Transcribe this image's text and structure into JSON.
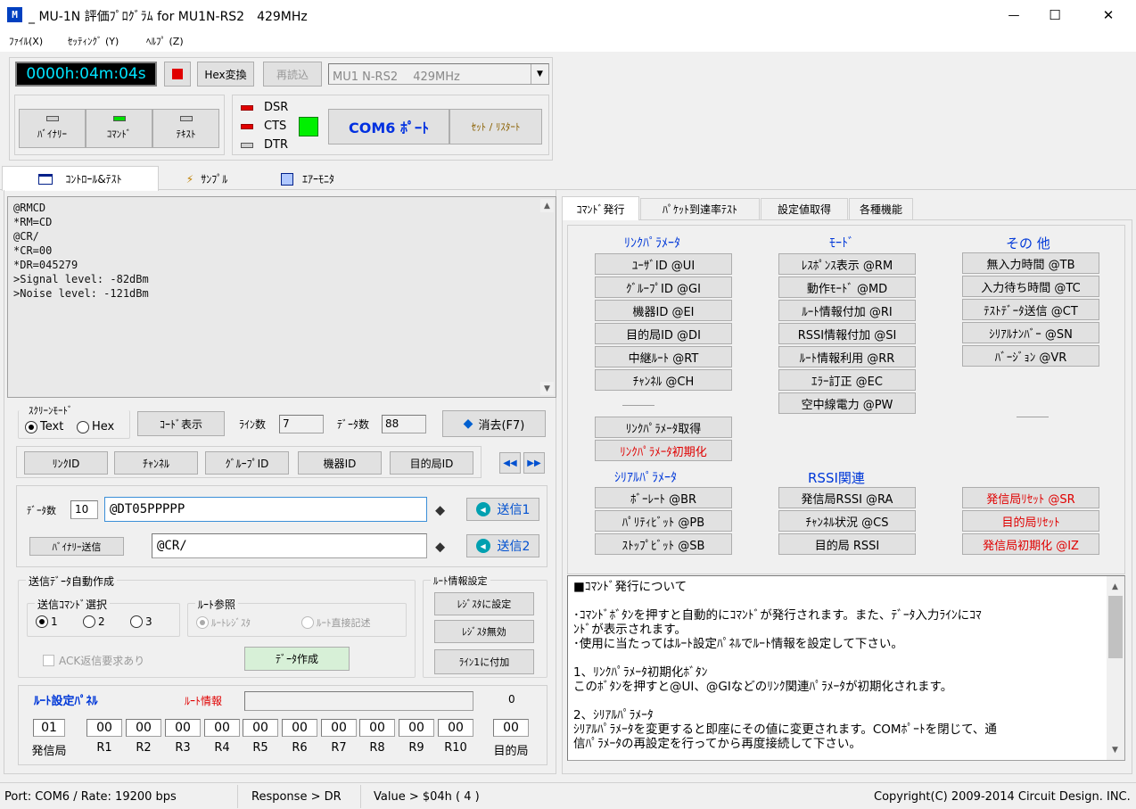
{
  "window": {
    "title": "_ MU-1N 評価ﾌﾟﾛｸﾞﾗﾑ for MU1N-RS2　429MHz",
    "minimize": "—",
    "maximize": "☐",
    "close": "✕"
  },
  "menu": [
    "ﾌｧｲﾙ(X)",
    "ｾｯﾃｨﾝｸﾞ (Y)",
    "ﾍﾙﾌﾟ (Z)"
  ],
  "toolbar": {
    "timer": "0000h:04m:04s",
    "hex_label": "Hex変換",
    "reload_label": "再読込",
    "device_value": "MU1 N-RS2　 429MHz",
    "mode_buttons": [
      "ﾊﾞｲﾅﾘｰ",
      "ｺﾏﾝﾄﾞ",
      "ﾃｷｽﾄ"
    ],
    "dsr": "DSR",
    "cts": "CTS",
    "dtr": "DTR",
    "com_port": "COM6 ﾎﾟｰﾄ",
    "reset_label": "ｾｯﾄ / ﾘｽﾀｰﾄ"
  },
  "main_tabs": [
    "ｺﾝﾄﾛｰﾙ&ﾃｽﾄ",
    "ｻﾝﾌﾟﾙ",
    "ｴｱｰﾓﾆﾀ"
  ],
  "terminal": {
    "lines": [
      "@RMCD",
      "*RM=CD",
      "@CR/",
      "*CR=00",
      "*DR=045279",
      ">Signal level: -82dBm",
      ">Noise level:  -121dBm"
    ]
  },
  "screen": {
    "group_label": "ｽｸﾘｰﾝﾓｰﾄﾞ",
    "text_label": "Text",
    "hex_label": "Hex",
    "code_button": "ｺｰﾄﾞ表示",
    "lines_label": "ﾗｲﾝ数",
    "lines_value": "7",
    "data_label": "ﾃﾞｰﾀ数",
    "data_value": "88",
    "clear_button": "消去(F7)"
  },
  "id_buttons": [
    "ﾘﾝｸID",
    "ﾁｬﾝﾈﾙ",
    "ｸﾞﾙｰﾌﾟID",
    "機器ID",
    "目的局ID"
  ],
  "send": {
    "count_label": "ﾃﾞｰﾀ数",
    "count_value": "10",
    "line1": "@DT05PPPPP",
    "line2": "@CR/",
    "binary_button": "ﾊﾞｲﾅﾘｰ送信",
    "send1": "送信1",
    "send2": "送信2"
  },
  "auto": {
    "group_label": "送信ﾃﾞｰﾀ自動作成",
    "select_label": "送信ｺﾏﾝﾄﾞ選択",
    "options": [
      "1",
      "2",
      "3"
    ],
    "route_label": "ﾙｰﾄ参照",
    "route_reg": "ﾙｰﾄﾚｼﾞｽﾀ",
    "route_direct": "ﾙｰﾄ直接記述",
    "ack_label": "ACK返信要求あり",
    "make_button": "ﾃﾞｰﾀ作成"
  },
  "route_settings": {
    "group_label": "ﾙｰﾄ情報設定",
    "buttons": [
      "ﾚｼﾞｽﾀに設定",
      "ﾚｼﾞｽﾀ無効",
      "ﾗｲﾝ1に付加"
    ]
  },
  "route_panel": {
    "title": "ﾙｰﾄ設定ﾊﾟﾈﾙ",
    "info_label": "ﾙｰﾄ情報",
    "count": "0",
    "cells": [
      {
        "value": "01",
        "label": "発信局"
      },
      {
        "value": "00",
        "label": "R1"
      },
      {
        "value": "00",
        "label": "R2"
      },
      {
        "value": "00",
        "label": "R3"
      },
      {
        "value": "00",
        "label": "R4"
      },
      {
        "value": "00",
        "label": "R5"
      },
      {
        "value": "00",
        "label": "R6"
      },
      {
        "value": "00",
        "label": "R7"
      },
      {
        "value": "00",
        "label": "R8"
      },
      {
        "value": "00",
        "label": "R9"
      },
      {
        "value": "00",
        "label": "R10"
      },
      {
        "value": "00",
        "label": "目的局"
      }
    ]
  },
  "right_tabs": [
    "ｺﾏﾝﾄﾞ発行",
    "ﾊﾟｹｯﾄ到達率ﾃｽﾄ",
    "設定値取得",
    "各種機能"
  ],
  "commands": {
    "link_header": "ﾘﾝｸﾊﾟﾗﾒｰﾀ",
    "mode_header": "ﾓｰﾄﾞ",
    "other_header": "その 他",
    "link": [
      "ﾕｰｻﾞID @UI",
      "ｸﾞﾙｰﾌﾟID @GI",
      "機器ID @EI",
      "目的局ID @DI",
      "中継ﾙｰﾄ @RT",
      "ﾁｬﾝﾈﾙ @CH"
    ],
    "mode": [
      "ﾚｽﾎﾟﾝｽ表示 @RM",
      "動作ﾓｰﾄﾞ @MD",
      "ﾙｰﾄ情報付加 @RI",
      "RSSI情報付加 @SI",
      "ﾙｰﾄ情報利用 @RR",
      "ｴﾗｰ訂正 @EC",
      "空中線電力 @PW"
    ],
    "other": [
      "無入力時間 @TB",
      "入力待ち時間 @TC",
      "ﾃｽﾄﾃﾞｰﾀ送信 @CT",
      "ｼﾘｱﾙﾅﾝﾊﾞｰ @SN",
      "ﾊﾞｰｼﾞｮﾝ @VR"
    ],
    "link_get": "ﾘﾝｸﾊﾟﾗﾒｰﾀ取得",
    "link_init": "ﾘﾝｸﾊﾟﾗﾒｰﾀ初期化",
    "serial_header": "ｼﾘｱﾙﾊﾟﾗﾒｰﾀ",
    "rssi_header": "RSSI関連",
    "serial": [
      "ﾎﾞｰﾚｰﾄ @BR",
      "ﾊﾟﾘﾃｨﾋﾞｯﾄ @PB",
      "ｽﾄｯﾌﾟﾋﾞｯﾄ @SB"
    ],
    "rssi": [
      "発信局RSSI @RA",
      "ﾁｬﾝﾈﾙ状況 @CS",
      "目的局 RSSI"
    ],
    "reset": [
      "発信局ﾘｾｯﾄ @SR",
      "目的局ﾘｾｯﾄ",
      "発信局初期化 @IZ"
    ]
  },
  "help": {
    "title": "■ｺﾏﾝﾄﾞ発行について",
    "lines": [
      "",
      "･ｺﾏﾝﾄﾞﾎﾞﾀﾝを押すと自動的にｺﾏﾝﾄﾞが発行されます。また、ﾃﾞｰﾀ入力ﾗｲﾝにｺﾏ",
      "ﾝﾄﾞが表示されます。",
      "･使用に当たってはﾙｰﾄ設定ﾊﾟﾈﾙでﾙｰﾄ情報を設定して下さい。",
      "",
      "1、ﾘﾝｸﾊﾟﾗﾒｰﾀ初期化ﾎﾞﾀﾝ",
      "このﾎﾞﾀﾝを押すと@UI、@GIなどのﾘﾝｸ関連ﾊﾟﾗﾒｰﾀが初期化されます。",
      "",
      "2、ｼﾘｱﾙﾊﾟﾗﾒｰﾀ",
      "ｼﾘｱﾙﾊﾟﾗﾒｰﾀを変更すると即座にその値に変更されます。COMﾎﾟｰﾄを閉じて、通",
      "信ﾊﾟﾗﾒｰﾀの再設定を行ってから再度接続して下さい。"
    ]
  },
  "status": {
    "port": "Port: COM6 / Rate: 19200 bps",
    "response": "Response > DR",
    "value": "Value > $04h ( 4 )",
    "copyright": "Copyright(C) 2009-2014 Circuit Design. INC."
  },
  "colors": {
    "cts_on": "#00f000",
    "timer_bg": "#000000",
    "timer_fg": "#00e5ff",
    "accent_red": "#e00000",
    "accent_blue": "#0038d8"
  }
}
